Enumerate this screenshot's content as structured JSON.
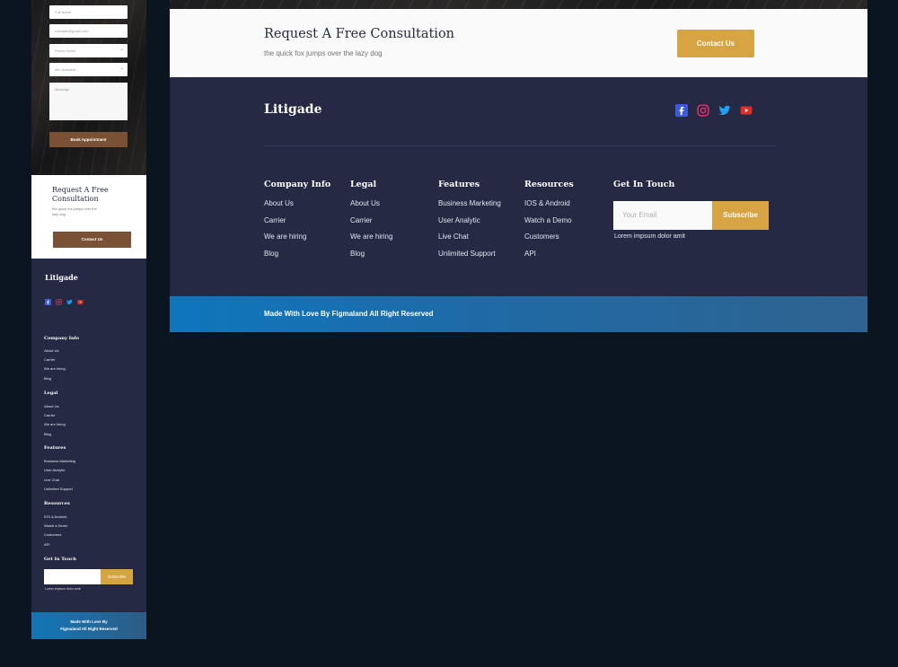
{
  "mobile": {
    "form": {
      "full_name_placeholder": "Full Name",
      "email_placeholder": "example@gmail.com",
      "phone_placeholder": "Phone Numb",
      "availability_placeholder": "Info Available",
      "message_placeholder": "Message",
      "book_button": "Book Appointment"
    },
    "cta": {
      "title": "Request A Free Consultation",
      "subtitle": "the quick fox jumps over the lazy dog",
      "button": "Contact Us"
    },
    "footer": {
      "brand": "Litigade",
      "columns": [
        {
          "title": "Company Info",
          "links": [
            "About Us",
            "Carrier",
            "We are hiring",
            "Blog"
          ]
        },
        {
          "title": "Legal",
          "links": [
            "About Us",
            "Carrier",
            "We are hiring",
            "Blog"
          ]
        },
        {
          "title": "Features",
          "links": [
            "Business Marketing",
            "User Analytic",
            "Live Chat",
            "Unlimited Support"
          ]
        },
        {
          "title": "Resources",
          "links": [
            "IOS & Android",
            "Watch a Demo",
            "Customers",
            "API"
          ]
        }
      ],
      "get_in_touch": "Get In Touch",
      "subscribe_button": "Subscribe",
      "lorem": "Lorem impsum dolor amit",
      "bottom_line1": "Made With Love By",
      "bottom_line2": "Figmaland All Right Reserved"
    }
  },
  "desktop": {
    "cta": {
      "title": "Request A Free Consultation",
      "subtitle": "the quick fox jumps over the lazy dog",
      "button": "Contact Us"
    },
    "footer": {
      "brand": "Litigade",
      "social_icons": [
        "facebook-icon",
        "instagram-icon",
        "twitter-icon",
        "youtube-icon"
      ],
      "columns": [
        {
          "title": "Company Info",
          "links": [
            "About Us",
            "Carrier",
            "We are hiring",
            "Blog"
          ]
        },
        {
          "title": "Legal",
          "links": [
            "About Us",
            "Carrier",
            "We are hiring",
            "Blog"
          ]
        },
        {
          "title": "Features",
          "links": [
            "Business Marketing",
            "User Analytic",
            "Live Chat",
            "Unlimited Support"
          ]
        },
        {
          "title": "Resources",
          "links": [
            "IOS & Android",
            "Watch a Demo",
            "Customers",
            "API"
          ]
        }
      ],
      "get_in_touch": "Get In Touch",
      "email_placeholder": "Your Email",
      "subscribe_button": "Subscribe",
      "lorem": "Lorem impsum dolor amit",
      "bottom_text": "Made With Love By Figmaland All Right Reserved"
    }
  },
  "colors": {
    "background": "#0b1520",
    "footer_bg": "#252944",
    "accent_gold": "#d6a443",
    "accent_brown": "#7a5135",
    "bottom_bar_blue": "#0f76bd",
    "facebook": "#3b5bdb",
    "instagram": "#e1306c",
    "twitter": "#1da1f2",
    "youtube": "#e02e24"
  }
}
